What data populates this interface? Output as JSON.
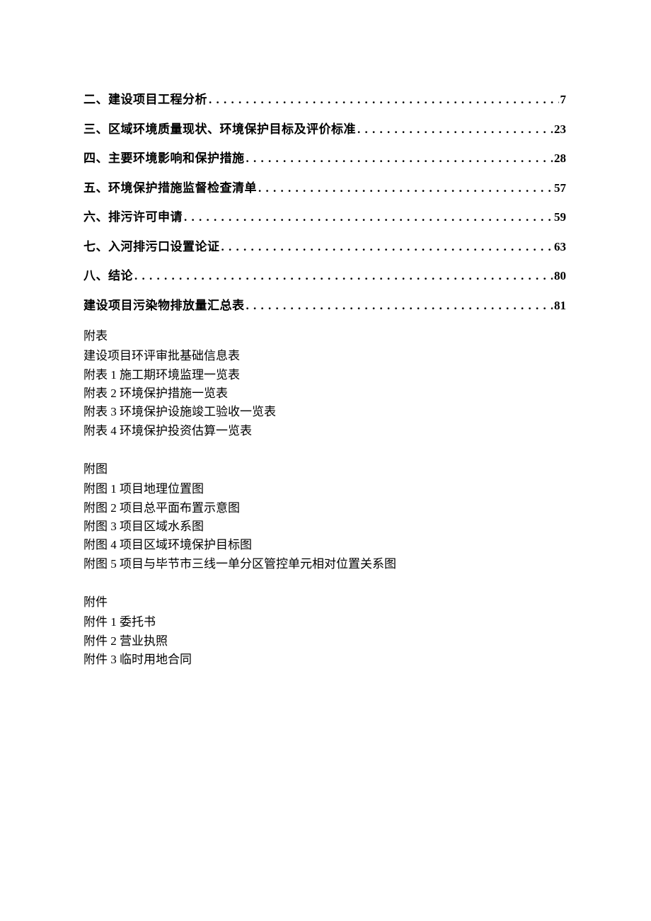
{
  "toc": [
    {
      "title": "二、建设项目工程分析",
      "page": "7"
    },
    {
      "title": "三、区域环境质量现状、环境保护目标及评价标准",
      "page": "23"
    },
    {
      "title": "四、主要环境影响和保护措施",
      "page": "28"
    },
    {
      "title": "五、环境保护措施监督检查清单",
      "page": "57"
    },
    {
      "title": "六、排污许可申请",
      "page": "59"
    },
    {
      "title": "七、入河排污口设置论证",
      "page": "63"
    },
    {
      "title": "八、结论",
      "page": "80"
    },
    {
      "title": "建设项目污染物排放量汇总表",
      "page": "81"
    }
  ],
  "appendixTables": {
    "heading": "附表",
    "items": [
      "建设项目环评审批基础信息表",
      "附表 1 施工期环境监理一览表",
      "附表 2 环境保护措施一览表",
      "附表 3 环境保护设施竣工验收一览表",
      "附表 4 环境保护投资估算一览表"
    ]
  },
  "appendixFigures": {
    "heading": "附图",
    "items": [
      "附图 1 项目地理位置图",
      "附图 2 项目总平面布置示意图",
      "附图 3 项目区域水系图",
      "附图 4 项目区域环境保护目标图",
      "附图 5 项目与毕节市三线一单分区管控单元相对位置关系图"
    ]
  },
  "attachments": {
    "heading": "附件",
    "items": [
      "附件 1 委托书",
      "附件 2 营业执照",
      "附件 3 临时用地合同"
    ]
  },
  "leader": ". . . . . . . . . . . . . . . . . . . . . . . . . . . . . . . . . . . . . . . . . . . . . . . . . . . . . . . . . . . . . . . . . . . . . . . . . . . . . . . . . . . . . . . . . . . . . . . . . . . . . . . . . . . . . . . . . . . . . . . . . . . ."
}
